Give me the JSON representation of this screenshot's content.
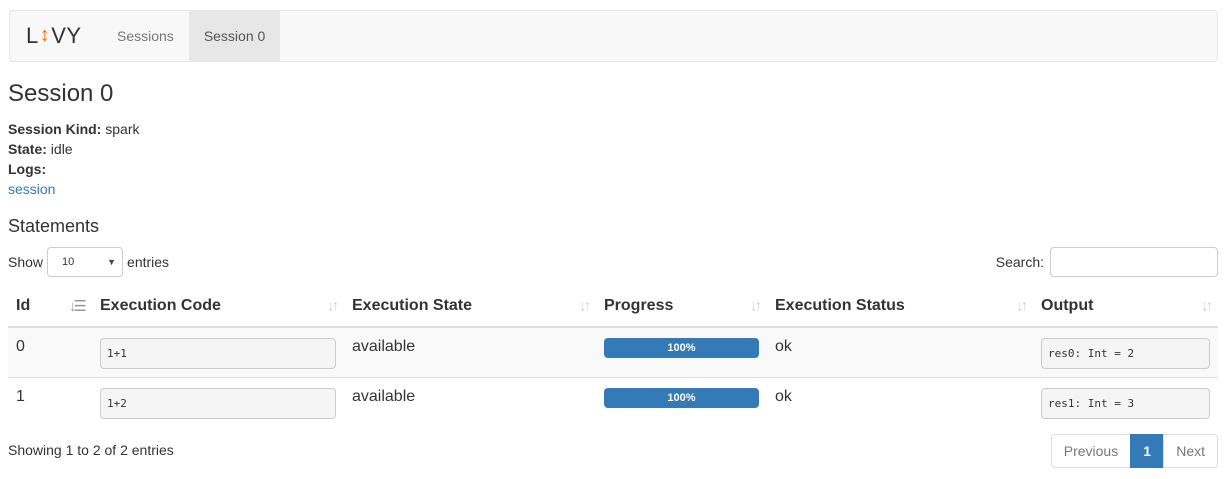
{
  "navbar": {
    "brand_left": "L",
    "brand_icon": "↕",
    "brand_right": "VY",
    "items": [
      {
        "label": "Sessions",
        "active": false
      },
      {
        "label": "Session 0",
        "active": true
      }
    ]
  },
  "page": {
    "title": "Session 0",
    "meta": {
      "kind_label": "Session Kind:",
      "kind_value": "spark",
      "state_label": "State:",
      "state_value": "idle",
      "logs_label": "Logs:",
      "logs_link": "session"
    }
  },
  "statements": {
    "title": "Statements",
    "length": {
      "prefix": "Show",
      "value": "10",
      "suffix": "entries"
    },
    "search": {
      "label": "Search:",
      "value": "",
      "placeholder": ""
    },
    "columns": [
      "Id",
      "Execution Code",
      "Execution State",
      "Progress",
      "Execution Status",
      "Output"
    ],
    "rows": [
      {
        "id": "0",
        "code": "1+1",
        "state": "available",
        "progress": 100,
        "progress_label": "100%",
        "status": "ok",
        "output": "res0: Int = 2"
      },
      {
        "id": "1",
        "code": "1+2",
        "state": "available",
        "progress": 100,
        "progress_label": "100%",
        "status": "ok",
        "output": "res1: Int = 3"
      }
    ],
    "info": "Showing 1 to 2 of 2 entries",
    "pagination": {
      "previous": "Previous",
      "current": "1",
      "next": "Next"
    }
  },
  "colors": {
    "accent": "#337ab7",
    "logo": "#e8711f"
  }
}
